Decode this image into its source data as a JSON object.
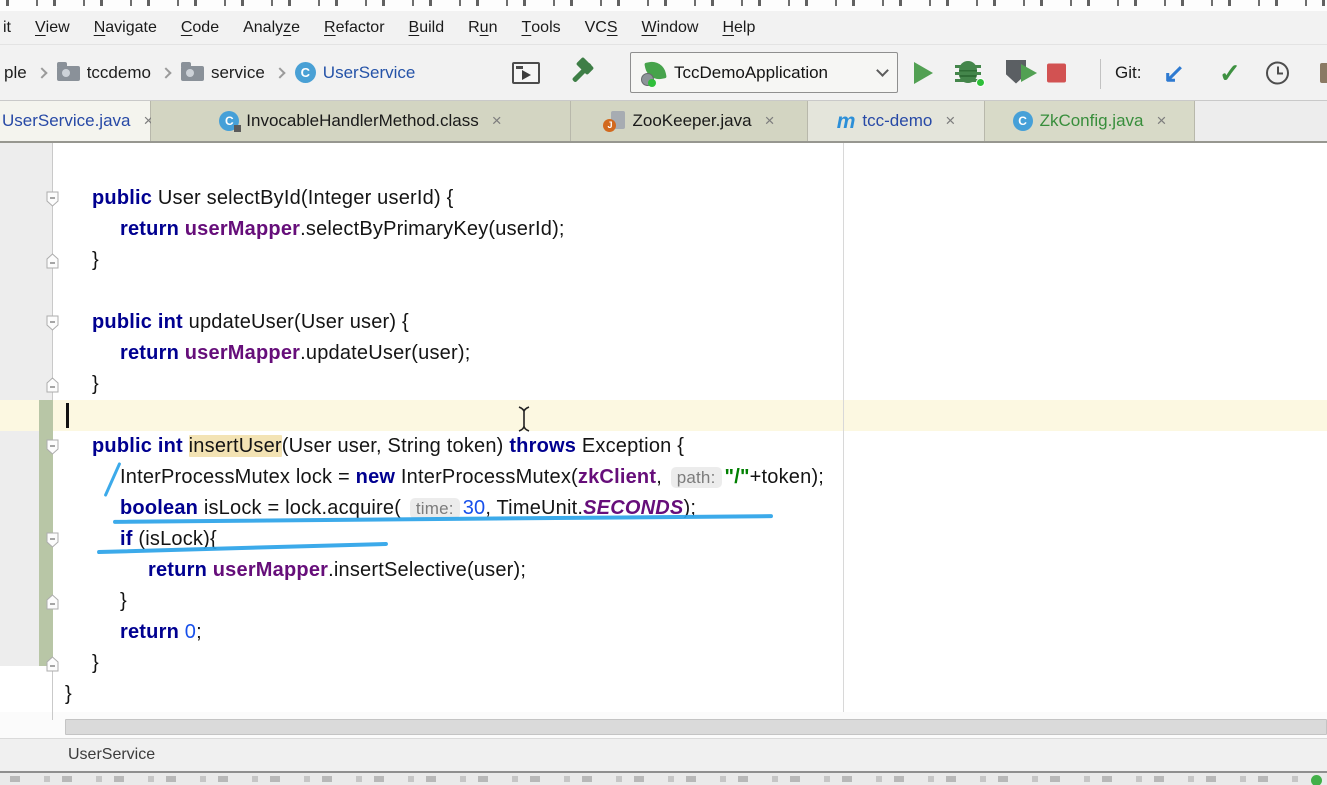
{
  "menu": {
    "items": [
      {
        "pre": "it",
        "u": "",
        "post": ""
      },
      {
        "pre": "",
        "u": "V",
        "post": "iew"
      },
      {
        "pre": "",
        "u": "N",
        "post": "avigate"
      },
      {
        "pre": "",
        "u": "C",
        "post": "ode"
      },
      {
        "pre": "Analy",
        "u": "z",
        "post": "e"
      },
      {
        "pre": "",
        "u": "R",
        "post": "efactor"
      },
      {
        "pre": "",
        "u": "B",
        "post": "uild"
      },
      {
        "pre": "R",
        "u": "u",
        "post": "n"
      },
      {
        "pre": "",
        "u": "T",
        "post": "ools"
      },
      {
        "pre": "VC",
        "u": "S",
        "post": ""
      },
      {
        "pre": "",
        "u": "W",
        "post": "indow"
      },
      {
        "pre": "",
        "u": "H",
        "post": "elp"
      }
    ]
  },
  "toolbar": {
    "breadcrumbs": [
      {
        "label": "ple",
        "type": "text"
      },
      {
        "label": "tccdemo",
        "type": "folder"
      },
      {
        "label": "service",
        "type": "folder"
      },
      {
        "label": "UserService",
        "type": "class",
        "icon_letter": "C"
      }
    ],
    "run_config": "TccDemoApplication",
    "git_label": "Git:",
    "git_update_glyph": "↙",
    "git_commit_glyph": "✓",
    "icons": [
      "run-window",
      "build-hammer",
      "spring-boot-run-config",
      "run",
      "debug",
      "run-with-coverage",
      "stop",
      "git-update",
      "git-commit",
      "history"
    ]
  },
  "tabs": [
    {
      "label": "UserService.java",
      "close": "×",
      "icon": "none",
      "state": "selected"
    },
    {
      "label": "InvocableHandlerMethod.class",
      "close": "×",
      "icon": "class",
      "icon_letter": "C",
      "state": "normal"
    },
    {
      "label": "ZooKeeper.java",
      "close": "×",
      "icon": "java-decompiled",
      "icon_letter": "J",
      "state": "normal"
    },
    {
      "label": "tcc-demo",
      "close": "×",
      "icon": "maven",
      "icon_letter": "m",
      "state": "normal"
    },
    {
      "label": "ZkConfig.java",
      "close": "×",
      "icon": "class",
      "icon_letter": "C",
      "state": "new-file"
    }
  ],
  "editor": {
    "lines": [
      {
        "indent": 1,
        "seg": [
          {
            "t": "public",
            "c": "kw"
          },
          {
            "t": " User selectById(Integer userId) {",
            "c": "pl"
          }
        ]
      },
      {
        "indent": 2,
        "seg": [
          {
            "t": "return",
            "c": "kw"
          },
          {
            "t": " ",
            "c": "pl"
          },
          {
            "t": "userMapper",
            "c": "fld"
          },
          {
            "t": ".selectByPrimaryKey(userId);",
            "c": "pl"
          }
        ]
      },
      {
        "indent": 1,
        "seg": [
          {
            "t": "}",
            "c": "pl"
          }
        ]
      },
      {
        "indent": 0,
        "seg": []
      },
      {
        "indent": 1,
        "seg": [
          {
            "t": "public int",
            "c": "kw"
          },
          {
            "t": " updateUser(User user) {",
            "c": "pl"
          }
        ]
      },
      {
        "indent": 2,
        "seg": [
          {
            "t": "return",
            "c": "kw"
          },
          {
            "t": " ",
            "c": "pl"
          },
          {
            "t": "userMapper",
            "c": "fld"
          },
          {
            "t": ".updateUser(user);",
            "c": "pl"
          }
        ]
      },
      {
        "indent": 1,
        "seg": [
          {
            "t": "}",
            "c": "pl"
          }
        ]
      },
      {
        "indent": 0,
        "seg": [],
        "current": true
      },
      {
        "indent": 1,
        "seg": [
          {
            "t": "public int",
            "c": "kw"
          },
          {
            "t": " ",
            "c": "pl"
          },
          {
            "t": "insertUser",
            "c": "hlid"
          },
          {
            "t": "(User user, String token) ",
            "c": "pl"
          },
          {
            "t": "throws",
            "c": "kw"
          },
          {
            "t": " Exception {",
            "c": "pl"
          }
        ]
      },
      {
        "indent": 2,
        "seg": [
          {
            "t": "InterProcessMutex lock = ",
            "c": "pl"
          },
          {
            "t": "new",
            "c": "kw"
          },
          {
            "t": " InterProcessMutex(",
            "c": "pl"
          },
          {
            "t": "zkClient",
            "c": "fld"
          },
          {
            "t": ", ",
            "c": "pl"
          },
          {
            "t": "path:",
            "c": "hint"
          },
          {
            "t": "\"/\"",
            "c": "str"
          },
          {
            "t": "+token);",
            "c": "pl"
          }
        ]
      },
      {
        "indent": 2,
        "seg": [
          {
            "t": "boolean",
            "c": "kw"
          },
          {
            "t": " isLock = lock.acquire( ",
            "c": "pl"
          },
          {
            "t": "time:",
            "c": "hint"
          },
          {
            "t": "30",
            "c": "num"
          },
          {
            "t": ", TimeUnit.",
            "c": "pl"
          },
          {
            "t": "SECONDS",
            "c": "cst"
          },
          {
            "t": ");",
            "c": "pl"
          }
        ]
      },
      {
        "indent": 2,
        "seg": [
          {
            "t": "if",
            "c": "kw"
          },
          {
            "t": " (isLock){",
            "c": "pl"
          }
        ]
      },
      {
        "indent": 3,
        "seg": [
          {
            "t": "return",
            "c": "kw"
          },
          {
            "t": " ",
            "c": "pl"
          },
          {
            "t": "userMapper",
            "c": "fld"
          },
          {
            "t": ".insertSelective(user);",
            "c": "pl"
          }
        ]
      },
      {
        "indent": 2,
        "seg": [
          {
            "t": "}",
            "c": "pl"
          }
        ]
      },
      {
        "indent": 2,
        "seg": [
          {
            "t": "return",
            "c": "kw"
          },
          {
            "t": " ",
            "c": "pl"
          },
          {
            "t": "0",
            "c": "num"
          },
          {
            "t": ";",
            "c": "pl"
          }
        ]
      },
      {
        "indent": 1,
        "seg": [
          {
            "t": "}",
            "c": "pl"
          }
        ]
      },
      {
        "indent": 0,
        "seg": [
          {
            "t": "}",
            "c": "pl"
          }
        ]
      }
    ],
    "folds": [
      {
        "line": 1,
        "dir": "down"
      },
      {
        "line": 3,
        "dir": "up"
      },
      {
        "line": 5,
        "dir": "down"
      },
      {
        "line": 7,
        "dir": "up"
      },
      {
        "line": 9,
        "dir": "down"
      },
      {
        "line": 12,
        "dir": "down"
      },
      {
        "line": 14,
        "dir": "up"
      },
      {
        "line": 16,
        "dir": "up"
      }
    ]
  },
  "bottom": {
    "breadcrumb": "UserService"
  },
  "colors": {
    "keyword": "#000090",
    "field": "#660e7a",
    "string": "#008000",
    "number": "#1750eb",
    "annotation_pen": "#2ba3e8",
    "run_green": "#52a053",
    "stop_red": "#d25252",
    "git_update_blue": "#2e7ad1",
    "tab_modified_blue": "#2749a6",
    "tab_new_green": "#388e3c",
    "vcs_added_gutter": "#b8c6a6",
    "current_line": "#fcf8e1",
    "identifier_highlight": "#f3e3b4"
  }
}
